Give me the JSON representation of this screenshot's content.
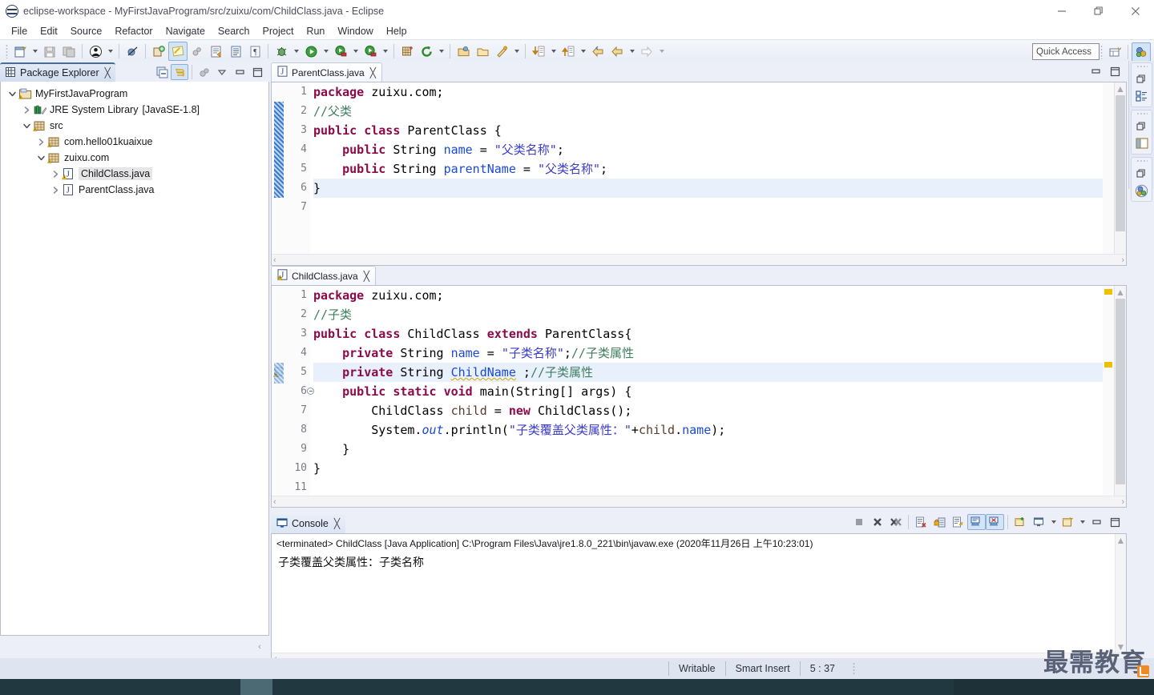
{
  "window": {
    "title": "eclipse-workspace - MyFirstJavaProgram/src/zuixu/com/ChildClass.java - Eclipse",
    "icon": "eclipse-icon",
    "controls": {
      "minimize": "minimize-icon",
      "restore": "restore-icon",
      "close": "close-icon"
    }
  },
  "menu": {
    "items": [
      "File",
      "Edit",
      "Source",
      "Refactor",
      "Navigate",
      "Search",
      "Project",
      "Run",
      "Window",
      "Help"
    ]
  },
  "toolbar": {
    "quick_access_placeholder": "Quick Access",
    "buttons": [
      "new-wizard-icon",
      "save-icon",
      "save-all-icon",
      "print-icon",
      "toggle-breakpoint-icon",
      "skip-breakpoints-icon",
      "new-java-project-icon",
      "new-java-class-icon",
      "open-type-icon",
      "open-task-icon",
      "toggle-mark-occurrences-icon",
      "debug-icon",
      "run-icon",
      "run-last-tool-icon",
      "external-tools-icon",
      "new-package-icon",
      "refresh-icon",
      "open-resource-icon",
      "search-icon",
      "next-annotation-icon",
      "previous-annotation-icon",
      "back-icon",
      "forward-icon"
    ]
  },
  "package_explorer": {
    "title": "Package Explorer",
    "close_label": "╳",
    "tools": [
      "collapse-all-icon",
      "link-with-editor-icon",
      "view-menu-icon",
      "minimize-icon",
      "maximize-icon"
    ],
    "tree": [
      {
        "label": "MyFirstJavaProgram",
        "suffix": "",
        "indent": 0,
        "twisty": "down",
        "icon": "java-project-icon",
        "selected": false
      },
      {
        "label": "JRE System Library",
        "suffix": "[JavaSE-1.8]",
        "indent": 1,
        "twisty": "right",
        "icon": "library-icon",
        "selected": false
      },
      {
        "label": "src",
        "suffix": "",
        "indent": 1,
        "twisty": "down",
        "icon": "source-folder-icon",
        "selected": false
      },
      {
        "label": "com.hello01kuaixue",
        "suffix": "",
        "indent": 2,
        "twisty": "right",
        "icon": "package-icon",
        "selected": false
      },
      {
        "label": "zuixu.com",
        "suffix": "",
        "indent": 2,
        "twisty": "down",
        "icon": "package-icon",
        "selected": false
      },
      {
        "label": "ChildClass.java",
        "suffix": "",
        "indent": 3,
        "twisty": "right",
        "icon": "java-file-warning-icon",
        "selected": true
      },
      {
        "label": "ParentClass.java",
        "suffix": "",
        "indent": 3,
        "twisty": "right",
        "icon": "java-file-icon",
        "selected": false
      }
    ]
  },
  "editors": [
    {
      "tab_label": "ParentClass.java",
      "tab_icon": "java-file-icon",
      "close_label": "╳",
      "lines": [
        {
          "no": "1",
          "highlight": false,
          "tokens": [
            {
              "t": "package",
              "c": "kw"
            },
            {
              "t": " zuixu.com;",
              "c": ""
            }
          ]
        },
        {
          "no": "2",
          "highlight": false,
          "tokens": [
            {
              "t": "//父类",
              "c": "cmt"
            }
          ]
        },
        {
          "no": "3",
          "highlight": false,
          "tokens": [
            {
              "t": "public",
              "c": "kw"
            },
            {
              "t": " ",
              "c": ""
            },
            {
              "t": "class",
              "c": "kw"
            },
            {
              "t": " ParentClass ",
              "c": ""
            },
            {
              "t": "{",
              "c": "brk"
            }
          ]
        },
        {
          "no": "4",
          "highlight": false,
          "tokens": [
            {
              "t": "    ",
              "c": ""
            },
            {
              "t": "public",
              "c": "kw"
            },
            {
              "t": " String ",
              "c": ""
            },
            {
              "t": "name",
              "c": "fld"
            },
            {
              "t": " = ",
              "c": ""
            },
            {
              "t": "\"父类名称\"",
              "c": "str"
            },
            {
              "t": ";",
              "c": ""
            }
          ]
        },
        {
          "no": "5",
          "highlight": false,
          "tokens": [
            {
              "t": "    ",
              "c": ""
            },
            {
              "t": "public",
              "c": "kw"
            },
            {
              "t": " String ",
              "c": ""
            },
            {
              "t": "parentName",
              "c": "fld"
            },
            {
              "t": " = ",
              "c": ""
            },
            {
              "t": "\"父类名称\"",
              "c": "str"
            },
            {
              "t": ";",
              "c": ""
            }
          ]
        },
        {
          "no": "6",
          "highlight": true,
          "tokens": [
            {
              "t": "}",
              "c": ""
            }
          ]
        },
        {
          "no": "7",
          "highlight": false,
          "tokens": [
            {
              "t": "",
              "c": ""
            }
          ]
        }
      ]
    },
    {
      "tab_label": "ChildClass.java",
      "tab_icon": "java-file-warning-icon",
      "close_label": "╳",
      "lines": [
        {
          "no": "1",
          "highlight": false,
          "tokens": [
            {
              "t": "package",
              "c": "kw"
            },
            {
              "t": " zuixu.com;",
              "c": ""
            }
          ]
        },
        {
          "no": "2",
          "highlight": false,
          "tokens": [
            {
              "t": "//子类",
              "c": "cmt"
            }
          ]
        },
        {
          "no": "3",
          "highlight": false,
          "tokens": [
            {
              "t": "public",
              "c": "kw"
            },
            {
              "t": " ",
              "c": ""
            },
            {
              "t": "class",
              "c": "kw"
            },
            {
              "t": " ChildClass ",
              "c": ""
            },
            {
              "t": "extends",
              "c": "kw"
            },
            {
              "t": " ParentClass{",
              "c": ""
            }
          ]
        },
        {
          "no": "4",
          "highlight": false,
          "tokens": [
            {
              "t": "    ",
              "c": ""
            },
            {
              "t": "private",
              "c": "kw"
            },
            {
              "t": " String ",
              "c": ""
            },
            {
              "t": "name",
              "c": "fld"
            },
            {
              "t": " = ",
              "c": ""
            },
            {
              "t": "\"子类名称\"",
              "c": "str"
            },
            {
              "t": ";",
              "c": ""
            },
            {
              "t": "//子类属性",
              "c": "cmt"
            }
          ]
        },
        {
          "no": "5",
          "highlight": true,
          "tokens": [
            {
              "t": "    ",
              "c": ""
            },
            {
              "t": "private",
              "c": "kw"
            },
            {
              "t": " String ",
              "c": ""
            },
            {
              "t": "ChildName",
              "c": "fld squig"
            },
            {
              "t": " ;",
              "c": ""
            },
            {
              "t": "//子类属性",
              "c": "cmt"
            }
          ]
        },
        {
          "no": "6",
          "highlight": false,
          "folding": true,
          "tokens": [
            {
              "t": "    ",
              "c": ""
            },
            {
              "t": "public",
              "c": "kw"
            },
            {
              "t": " ",
              "c": ""
            },
            {
              "t": "static",
              "c": "kw"
            },
            {
              "t": " ",
              "c": ""
            },
            {
              "t": "void",
              "c": "kw"
            },
            {
              "t": " main(String[] args) {",
              "c": ""
            }
          ]
        },
        {
          "no": "7",
          "highlight": false,
          "tokens": [
            {
              "t": "        ChildClass ",
              "c": ""
            },
            {
              "t": "child",
              "c": "lcl"
            },
            {
              "t": " = ",
              "c": ""
            },
            {
              "t": "new",
              "c": "kw"
            },
            {
              "t": " ChildClass();",
              "c": ""
            }
          ]
        },
        {
          "no": "8",
          "highlight": false,
          "tokens": [
            {
              "t": "        System.",
              "c": ""
            },
            {
              "t": "out",
              "c": "stc"
            },
            {
              "t": ".println(",
              "c": ""
            },
            {
              "t": "\"子类覆盖父类属性：\"",
              "c": "str"
            },
            {
              "t": "+",
              "c": ""
            },
            {
              "t": "child",
              "c": "lcl"
            },
            {
              "t": ".",
              "c": ""
            },
            {
              "t": "name",
              "c": "fld"
            },
            {
              "t": ");",
              "c": ""
            }
          ]
        },
        {
          "no": "9",
          "highlight": false,
          "tokens": [
            {
              "t": "    }",
              "c": ""
            }
          ]
        },
        {
          "no": "10",
          "highlight": false,
          "tokens": [
            {
              "t": "}",
              "c": ""
            }
          ]
        },
        {
          "no": "11",
          "highlight": false,
          "tokens": [
            {
              "t": "",
              "c": ""
            }
          ]
        }
      ]
    }
  ],
  "console": {
    "tab_label": "Console",
    "tab_icon": "console-icon",
    "close_label": "╳",
    "header": "<terminated> ChildClass [Java Application] C:\\Program Files\\Java\\jre1.8.0_221\\bin\\javaw.exe (2020年11月26日 上午10:23:01)",
    "output": "子类覆盖父类属性：子类名称",
    "tools": [
      "terminate-icon",
      "remove-launch-icon",
      "remove-all-terminated-icon",
      "clear-console-icon",
      "scroll-lock-icon",
      "word-wrap-icon",
      "show-console-on-output-icon",
      "show-console-on-error-icon",
      "pin-console-icon",
      "display-selected-console-icon",
      "open-console-icon",
      "minimize-icon",
      "maximize-icon"
    ]
  },
  "right_rail": {
    "groups": [
      {
        "restore": "restore-icon",
        "view": "outline-icon"
      },
      {
        "restore": "restore-icon",
        "view": "task-list-icon"
      },
      {
        "restore": "restore-icon",
        "view": "java-perspective-icon"
      }
    ]
  },
  "statusbar": {
    "writable": "Writable",
    "insert_mode": "Smart Insert",
    "position": "5 : 37"
  },
  "watermark": {
    "text": "最需教育",
    "badge": "rss-icon"
  },
  "colors": {
    "keyword": "#8a0a4a",
    "field": "#1a49d6",
    "string": "#3b3bc4",
    "comment": "#3f7f5f",
    "local": "#5a3b2e",
    "highlight_line": "#e8f0fb",
    "accent": "#4a6c9b"
  }
}
